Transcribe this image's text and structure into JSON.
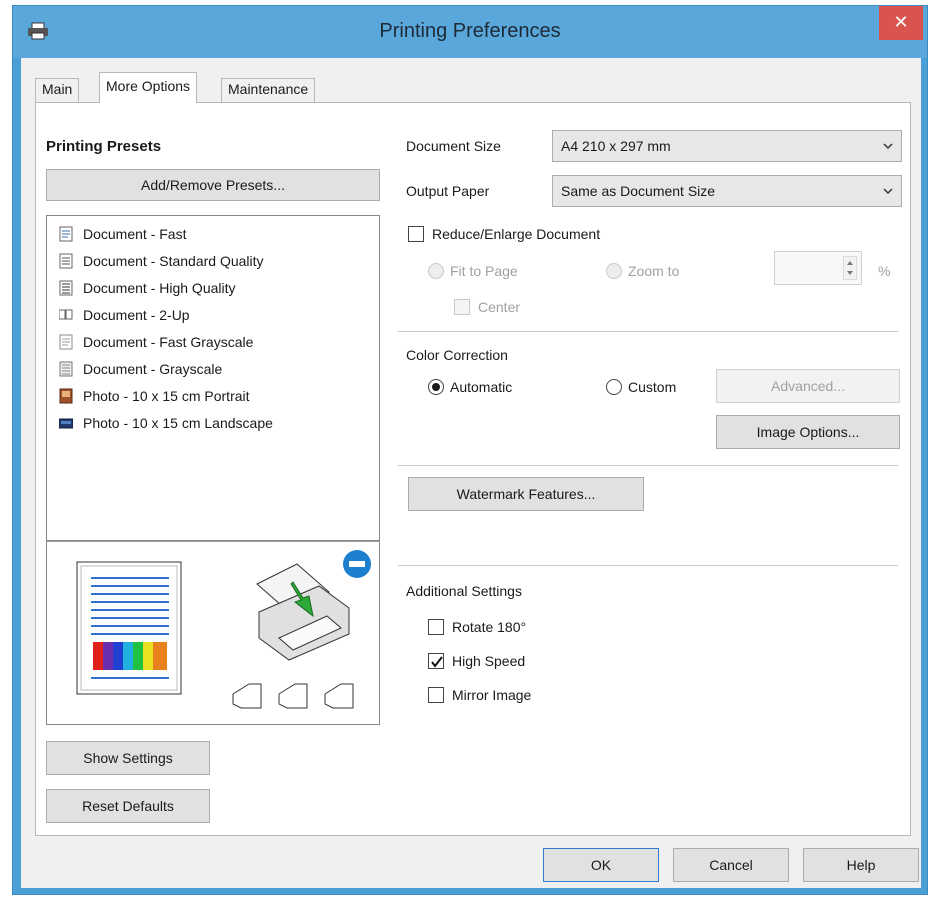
{
  "window": {
    "title": "Printing Preferences",
    "close_symbol": "✕"
  },
  "tabs": [
    {
      "label": "Main"
    },
    {
      "label": "More Options",
      "active": true
    },
    {
      "label": "Maintenance"
    }
  ],
  "presets": {
    "heading": "Printing Presets",
    "add_remove_button": "Add/Remove Presets...",
    "items": [
      {
        "label": "Document - Fast",
        "icon": "document-fast-icon"
      },
      {
        "label": "Document - Standard Quality",
        "icon": "document-standard-icon"
      },
      {
        "label": "Document - High Quality",
        "icon": "document-high-quality-icon"
      },
      {
        "label": "Document - 2-Up",
        "icon": "document-2up-icon"
      },
      {
        "label": "Document - Fast Grayscale",
        "icon": "document-fast-grayscale-icon"
      },
      {
        "label": "Document - Grayscale",
        "icon": "document-grayscale-icon"
      },
      {
        "label": "Photo - 10 x 15 cm Portrait",
        "icon": "photo-portrait-icon"
      },
      {
        "label": "Photo - 10 x 15 cm Landscape",
        "icon": "photo-landscape-icon"
      }
    ]
  },
  "paper": {
    "document_size_label": "Document Size",
    "document_size_value": "A4 210 x 297 mm",
    "output_paper_label": "Output Paper",
    "output_paper_value": "Same as Document Size"
  },
  "reduce_enlarge": {
    "label": "Reduce/Enlarge Document",
    "checked": false,
    "fit_to_page": "Fit to Page",
    "zoom_to": "Zoom to",
    "center": "Center",
    "zoom_value": "",
    "percent": "%"
  },
  "color_correction": {
    "label": "Color Correction",
    "automatic": "Automatic",
    "custom": "Custom",
    "selected": "Automatic",
    "advanced_button": "Advanced...",
    "image_options_button": "Image Options..."
  },
  "watermark_button": "Watermark Features...",
  "additional": {
    "label": "Additional Settings",
    "rotate": {
      "label": "Rotate 180°",
      "checked": false
    },
    "high_speed": {
      "label": "High Speed",
      "checked": true
    },
    "mirror": {
      "label": "Mirror Image",
      "checked": false
    }
  },
  "bottom_buttons": {
    "show_settings": "Show Settings",
    "reset_defaults": "Reset Defaults",
    "ok": "OK",
    "cancel": "Cancel",
    "help": "Help"
  },
  "colors": {
    "title_bar": "#5aa7dc",
    "close_button": "#d9534f",
    "accent_blue": "#1e7fd0"
  }
}
